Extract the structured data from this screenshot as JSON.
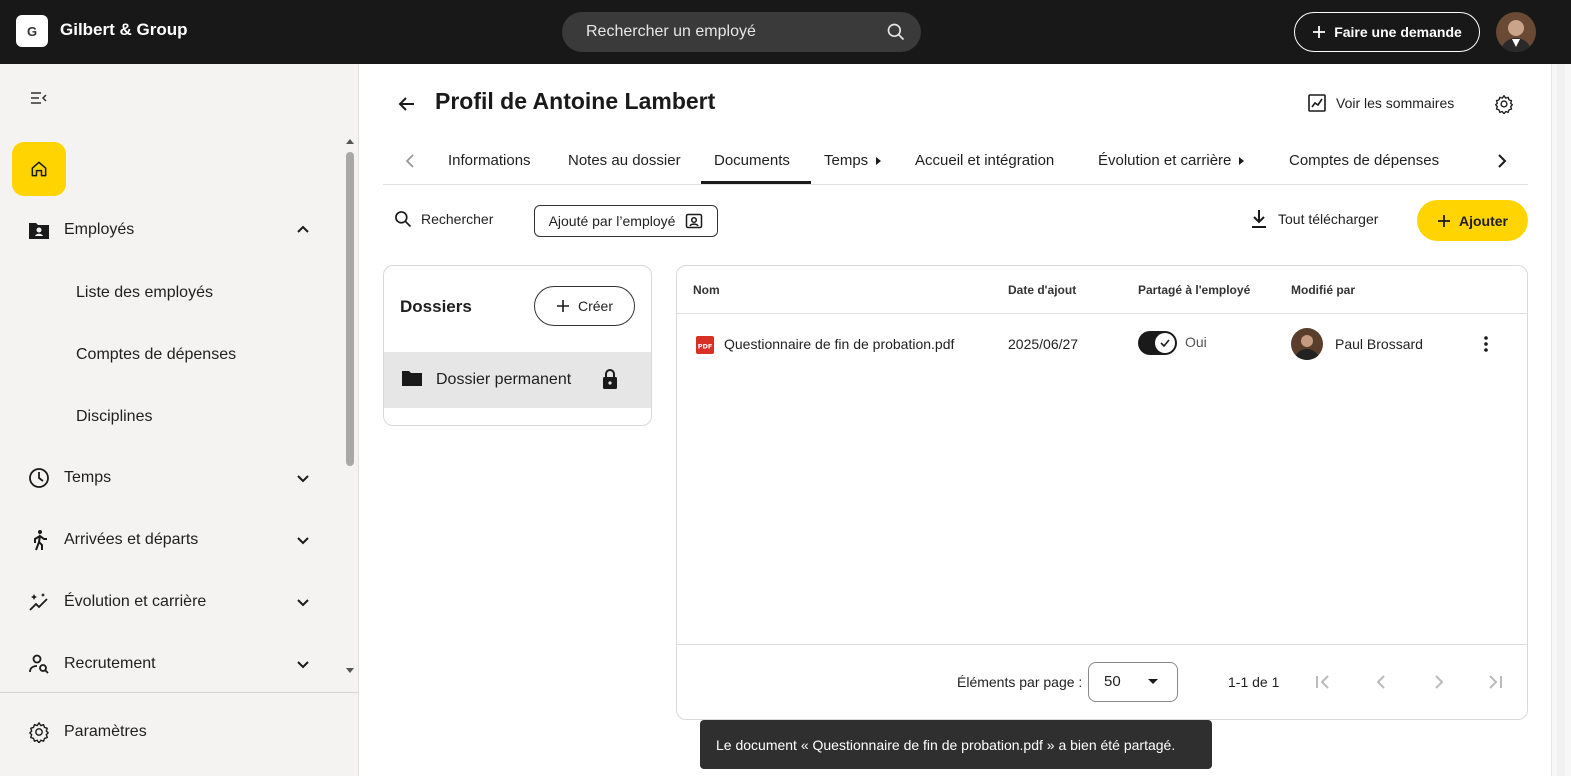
{
  "topbar": {
    "logo_letter": "G",
    "brand": "Gilbert & Group",
    "search_placeholder": "Rechercher un employé",
    "request_button": "Faire une demande"
  },
  "sidebar": {
    "sections": [
      {
        "label": "Employés",
        "icon": "person-folder-icon",
        "expanded": true,
        "children": [
          "Liste des employés",
          "Comptes de dépenses",
          "Disciplines"
        ]
      },
      {
        "label": "Temps",
        "icon": "clock-icon"
      },
      {
        "label": "Arrivées et départs",
        "icon": "walking-person-icon"
      },
      {
        "label": "Évolution et carrière",
        "icon": "sparkle-trend-icon"
      },
      {
        "label": "Recrutement",
        "icon": "person-search-icon"
      }
    ],
    "settings": "Paramètres"
  },
  "page": {
    "title": "Profil de Antoine Lambert",
    "summaries_link": "Voir les sommaires"
  },
  "tabs": [
    "Informations",
    "Notes au dossier",
    "Documents",
    "Temps",
    "Accueil et intégration",
    "Évolution et carrière",
    "Comptes de dépenses"
  ],
  "active_tab": "Documents",
  "toolbar": {
    "search": "Rechercher",
    "filter_chip": "Ajouté par l’employé",
    "download_all": "Tout télécharger",
    "add": "Ajouter"
  },
  "folders": {
    "title": "Dossiers",
    "create": "Créer",
    "items": [
      {
        "name": "Dossier permanent",
        "locked": true,
        "selected": true
      }
    ]
  },
  "table": {
    "headers": [
      "Nom",
      "Date d'ajout",
      "Partagé à l'employé",
      "Modifié par"
    ],
    "rows": [
      {
        "name": "Questionnaire de fin de probation.pdf",
        "date": "2025/06/27",
        "shared": "Oui",
        "shared_on": true,
        "modified_by": "Paul Brossard"
      }
    ],
    "footer": {
      "per_page_label": "Éléments par page :",
      "per_page_value": "50",
      "range": "1-1 de 1"
    }
  },
  "snackbar": "Le document « Questionnaire de fin de probation.pdf » a bien été partagé.",
  "colors": {
    "accent": "#ffd400",
    "topbar": "#181818",
    "sidebar": "#f4f3f1"
  }
}
